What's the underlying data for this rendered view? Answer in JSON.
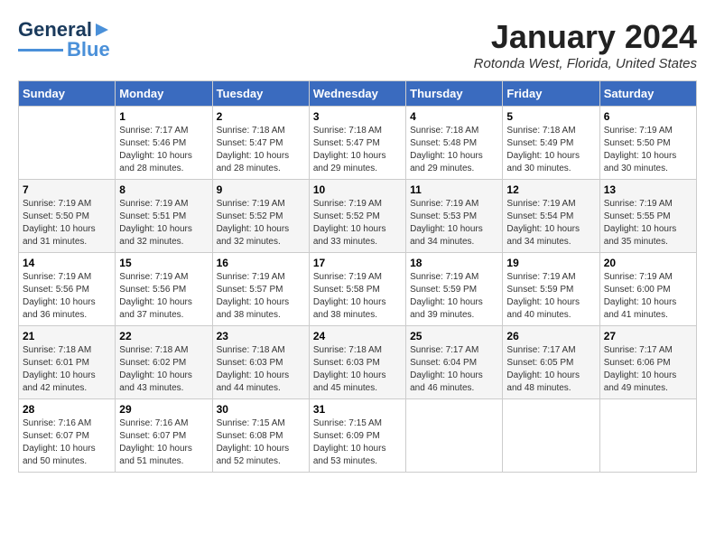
{
  "header": {
    "logo_line1": "General",
    "logo_line2": "Blue",
    "month": "January 2024",
    "location": "Rotonda West, Florida, United States"
  },
  "days_of_week": [
    "Sunday",
    "Monday",
    "Tuesday",
    "Wednesday",
    "Thursday",
    "Friday",
    "Saturday"
  ],
  "weeks": [
    [
      {
        "day": "",
        "info": ""
      },
      {
        "day": "1",
        "info": "Sunrise: 7:17 AM\nSunset: 5:46 PM\nDaylight: 10 hours\nand 28 minutes."
      },
      {
        "day": "2",
        "info": "Sunrise: 7:18 AM\nSunset: 5:47 PM\nDaylight: 10 hours\nand 28 minutes."
      },
      {
        "day": "3",
        "info": "Sunrise: 7:18 AM\nSunset: 5:47 PM\nDaylight: 10 hours\nand 29 minutes."
      },
      {
        "day": "4",
        "info": "Sunrise: 7:18 AM\nSunset: 5:48 PM\nDaylight: 10 hours\nand 29 minutes."
      },
      {
        "day": "5",
        "info": "Sunrise: 7:18 AM\nSunset: 5:49 PM\nDaylight: 10 hours\nand 30 minutes."
      },
      {
        "day": "6",
        "info": "Sunrise: 7:19 AM\nSunset: 5:50 PM\nDaylight: 10 hours\nand 30 minutes."
      }
    ],
    [
      {
        "day": "7",
        "info": "Sunrise: 7:19 AM\nSunset: 5:50 PM\nDaylight: 10 hours\nand 31 minutes."
      },
      {
        "day": "8",
        "info": "Sunrise: 7:19 AM\nSunset: 5:51 PM\nDaylight: 10 hours\nand 32 minutes."
      },
      {
        "day": "9",
        "info": "Sunrise: 7:19 AM\nSunset: 5:52 PM\nDaylight: 10 hours\nand 32 minutes."
      },
      {
        "day": "10",
        "info": "Sunrise: 7:19 AM\nSunset: 5:52 PM\nDaylight: 10 hours\nand 33 minutes."
      },
      {
        "day": "11",
        "info": "Sunrise: 7:19 AM\nSunset: 5:53 PM\nDaylight: 10 hours\nand 34 minutes."
      },
      {
        "day": "12",
        "info": "Sunrise: 7:19 AM\nSunset: 5:54 PM\nDaylight: 10 hours\nand 34 minutes."
      },
      {
        "day": "13",
        "info": "Sunrise: 7:19 AM\nSunset: 5:55 PM\nDaylight: 10 hours\nand 35 minutes."
      }
    ],
    [
      {
        "day": "14",
        "info": "Sunrise: 7:19 AM\nSunset: 5:56 PM\nDaylight: 10 hours\nand 36 minutes."
      },
      {
        "day": "15",
        "info": "Sunrise: 7:19 AM\nSunset: 5:56 PM\nDaylight: 10 hours\nand 37 minutes."
      },
      {
        "day": "16",
        "info": "Sunrise: 7:19 AM\nSunset: 5:57 PM\nDaylight: 10 hours\nand 38 minutes."
      },
      {
        "day": "17",
        "info": "Sunrise: 7:19 AM\nSunset: 5:58 PM\nDaylight: 10 hours\nand 38 minutes."
      },
      {
        "day": "18",
        "info": "Sunrise: 7:19 AM\nSunset: 5:59 PM\nDaylight: 10 hours\nand 39 minutes."
      },
      {
        "day": "19",
        "info": "Sunrise: 7:19 AM\nSunset: 5:59 PM\nDaylight: 10 hours\nand 40 minutes."
      },
      {
        "day": "20",
        "info": "Sunrise: 7:19 AM\nSunset: 6:00 PM\nDaylight: 10 hours\nand 41 minutes."
      }
    ],
    [
      {
        "day": "21",
        "info": "Sunrise: 7:18 AM\nSunset: 6:01 PM\nDaylight: 10 hours\nand 42 minutes."
      },
      {
        "day": "22",
        "info": "Sunrise: 7:18 AM\nSunset: 6:02 PM\nDaylight: 10 hours\nand 43 minutes."
      },
      {
        "day": "23",
        "info": "Sunrise: 7:18 AM\nSunset: 6:03 PM\nDaylight: 10 hours\nand 44 minutes."
      },
      {
        "day": "24",
        "info": "Sunrise: 7:18 AM\nSunset: 6:03 PM\nDaylight: 10 hours\nand 45 minutes."
      },
      {
        "day": "25",
        "info": "Sunrise: 7:17 AM\nSunset: 6:04 PM\nDaylight: 10 hours\nand 46 minutes."
      },
      {
        "day": "26",
        "info": "Sunrise: 7:17 AM\nSunset: 6:05 PM\nDaylight: 10 hours\nand 48 minutes."
      },
      {
        "day": "27",
        "info": "Sunrise: 7:17 AM\nSunset: 6:06 PM\nDaylight: 10 hours\nand 49 minutes."
      }
    ],
    [
      {
        "day": "28",
        "info": "Sunrise: 7:16 AM\nSunset: 6:07 PM\nDaylight: 10 hours\nand 50 minutes."
      },
      {
        "day": "29",
        "info": "Sunrise: 7:16 AM\nSunset: 6:07 PM\nDaylight: 10 hours\nand 51 minutes."
      },
      {
        "day": "30",
        "info": "Sunrise: 7:15 AM\nSunset: 6:08 PM\nDaylight: 10 hours\nand 52 minutes."
      },
      {
        "day": "31",
        "info": "Sunrise: 7:15 AM\nSunset: 6:09 PM\nDaylight: 10 hours\nand 53 minutes."
      },
      {
        "day": "",
        "info": ""
      },
      {
        "day": "",
        "info": ""
      },
      {
        "day": "",
        "info": ""
      }
    ]
  ]
}
